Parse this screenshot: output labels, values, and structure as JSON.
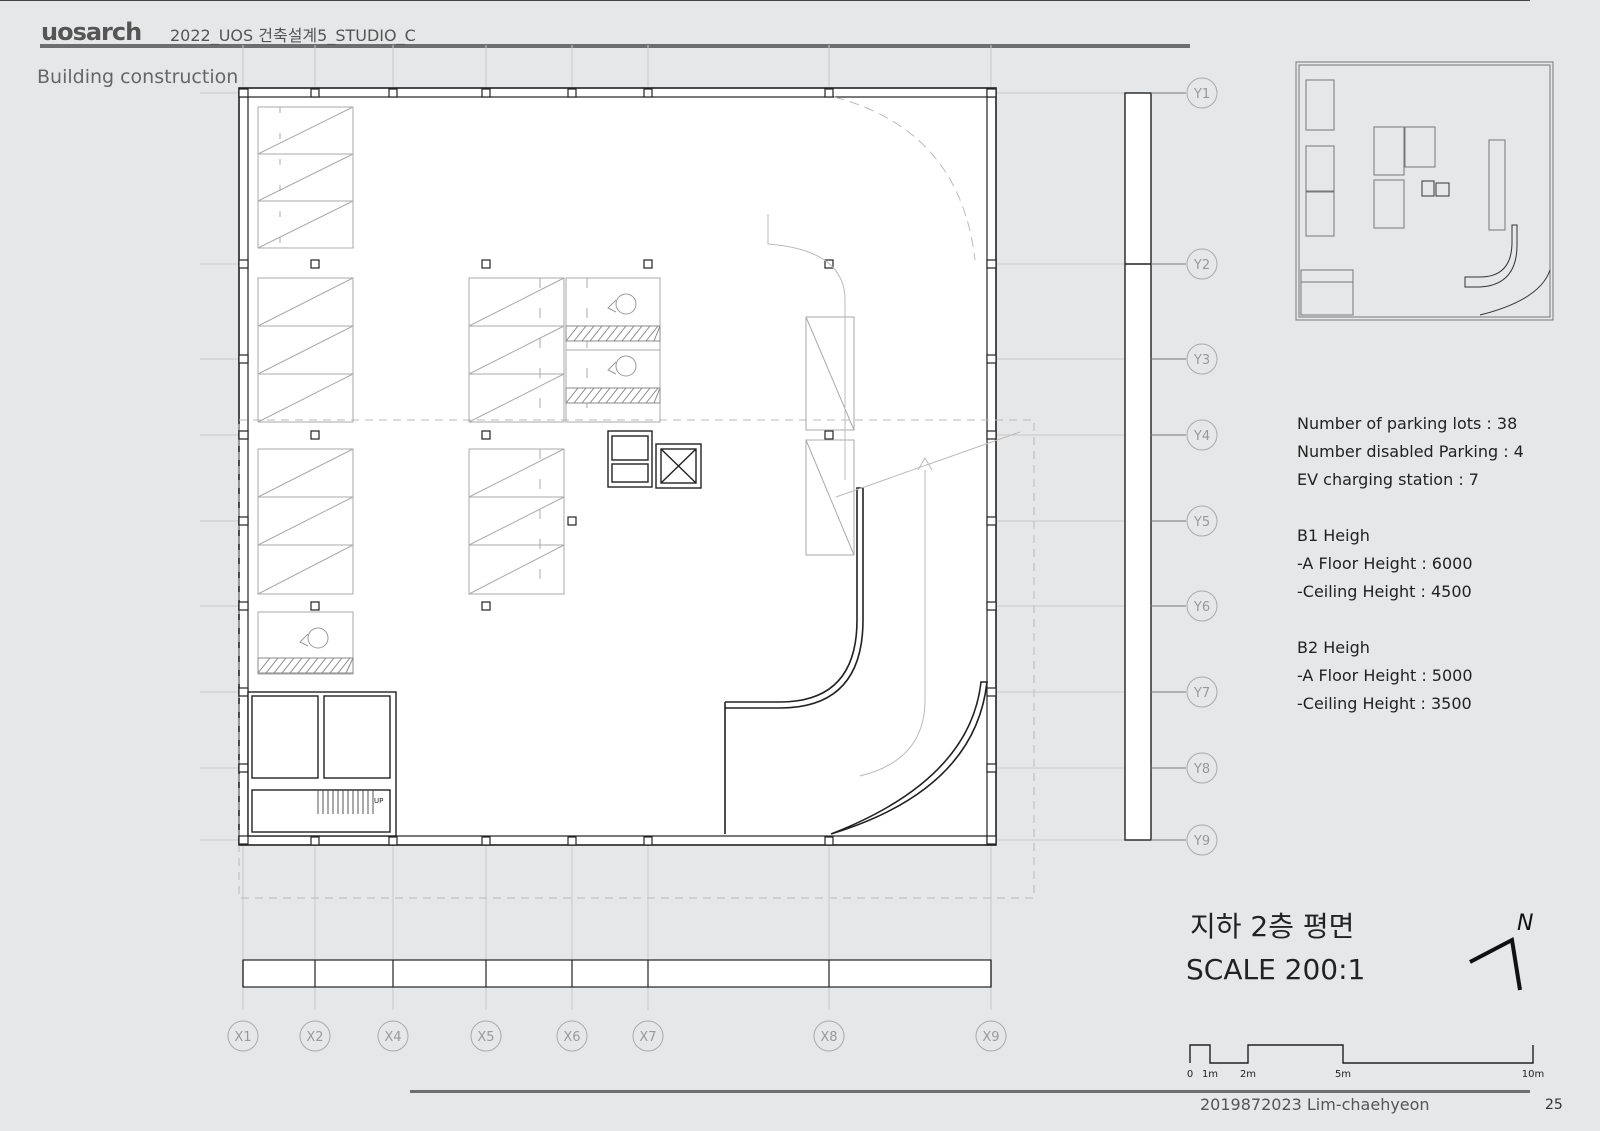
{
  "header": {
    "logo": "uosarch",
    "project": "2022_UOS 건축설계5_STUDIO_C",
    "subtitle": "Building construction"
  },
  "grid": {
    "x_labels": [
      "X1",
      "X2",
      "X4",
      "X5",
      "X6",
      "X7",
      "X8",
      "X9"
    ],
    "y_labels": [
      "Y1",
      "Y2",
      "Y3",
      "Y4",
      "Y5",
      "Y6",
      "Y7",
      "Y8",
      "Y9"
    ]
  },
  "plan": {
    "stair_label": "UP",
    "title": "지하 2층 평면",
    "scale": "SCALE 200:1",
    "north_label": "N"
  },
  "info": {
    "lines": [
      "Number of parking lots : 38",
      "Number disabled Parking : 4",
      "EV charging station : 7",
      "",
      "B1 Heigh",
      "-A Floor Height : 6000",
      "-Ceiling Height :  4500",
      "",
      "B2 Heigh",
      "-A Floor Height : 5000",
      "-Ceiling Height :  3500"
    ]
  },
  "scalebar": {
    "labels": [
      "0",
      "1m",
      "2m",
      "5m",
      "10m"
    ]
  },
  "footer": {
    "author": "2019872023 Lim-chaehyeon",
    "page": "25"
  }
}
